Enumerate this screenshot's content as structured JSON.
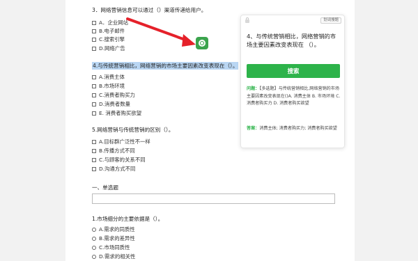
{
  "questions": {
    "q3": {
      "title": "3．网络营销信息可以通过（）渠道传递给用户。",
      "options": [
        "A．企业网站",
        "B.电子邮件",
        "C.搜索引擎",
        "D.网络广告"
      ]
    },
    "q4": {
      "title": "4.与传统营销相比，网络营销的市场主要因素改变表现在（）。",
      "options": [
        "A.消费主体",
        "B.市场环境",
        "C.消费者购买力",
        "D.消费者数量",
        "E. 消费者购买欲望"
      ]
    },
    "q5": {
      "title": "5.网络营销与传统营销的区别（）。",
      "options": [
        "A.目标群广泛性不一样",
        "B.传播方式不同",
        "C.与顾客的关系不同",
        "D.沟通方式不同"
      ]
    },
    "section": {
      "title": "一、单选题"
    },
    "q1": {
      "title": "1.市场细分的主要依据是（）。",
      "options": [
        "A.需求的同质性",
        "B.需求的差异性",
        "C.市场同质性",
        "D.需求的相关性"
      ]
    }
  },
  "popup": {
    "divide_button": "划词搜题",
    "question": "4、与传统营销相比，网络营销的市场主要因素改变表现在 （）。",
    "search_button": "搜索",
    "result_label": "问题：",
    "result_text": "【多选题】与传统营销相比,网络营销的市场主要因素改变表现在()A. 消费主体 B. 市场环境 C. 消费者购买力 D. 消费者购买欲望",
    "answer_label": "答案：",
    "answer_text": "消费主体; 消费者购买力; 消费者购买欲望"
  },
  "colors": {
    "accent_green": "#2db34a",
    "highlight_blue": "#b9d6f3",
    "arrow_red": "#e5212a"
  },
  "icons": {
    "search_fab": "search-icon",
    "lock": "lock-icon"
  }
}
